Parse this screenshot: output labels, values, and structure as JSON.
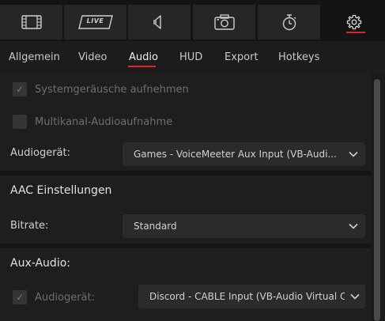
{
  "toolbar": {
    "buttons": [
      {
        "name": "film",
        "label": ""
      },
      {
        "name": "live",
        "label": "LIVE"
      },
      {
        "name": "audio",
        "label": ""
      },
      {
        "name": "camera",
        "label": ""
      },
      {
        "name": "timer",
        "label": ""
      },
      {
        "name": "settings",
        "label": ""
      }
    ],
    "active_index": 5,
    "accent": "#e0262c"
  },
  "subtabs": {
    "items": [
      "Allgemein",
      "Video",
      "Audio",
      "HUD",
      "Export",
      "Hotkeys"
    ],
    "active": "Audio"
  },
  "audio": {
    "system_sounds_label": "Systemgeräusche aufnehmen",
    "system_sounds_checked": true,
    "multichannel_label": "Multikanal-Audioaufnahme",
    "multichannel_checked": false,
    "device_label": "Audiogerät:",
    "device_value": "Games - VoiceMeeter Aux Input (VB-Audi...",
    "aac_heading": "AAC Einstellungen",
    "bitrate_label": "Bitrate:",
    "bitrate_value": "Standard",
    "aux_heading": "Aux-Audio:",
    "aux_device_label": "Audiogerät:",
    "aux_device_checked": true,
    "aux_device_value": "Discord - CABLE Input (VB-Audio Virtual Cab..."
  }
}
